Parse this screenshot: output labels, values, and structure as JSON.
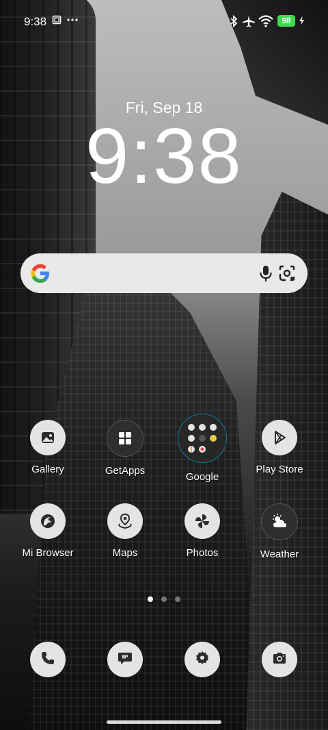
{
  "status_bar": {
    "time": "9:38",
    "battery": "98",
    "notification_icons": [
      "screenshot-icon",
      "more-dots-icon"
    ],
    "system_icons": [
      "bluetooth-icon",
      "airplane-icon",
      "wifi-icon",
      "battery-icon",
      "charging-icon"
    ],
    "battery_color": "#3ddc4f"
  },
  "lock_widget": {
    "date": "Fri, Sep 18",
    "time": "9:38"
  },
  "search": {
    "icons": [
      "google-logo-icon",
      "microphone-icon",
      "lens-camera-icon"
    ]
  },
  "apps_row1": [
    {
      "label": "Gallery",
      "icon": "gallery-icon"
    },
    {
      "label": "GetApps",
      "icon": "getapps-icon"
    },
    {
      "label": "Google",
      "icon": "google-folder-icon"
    },
    {
      "label": "Play Store",
      "icon": "play-store-icon"
    }
  ],
  "apps_row2": [
    {
      "label": "Mi Browser",
      "icon": "browser-icon"
    },
    {
      "label": "Maps",
      "icon": "maps-icon"
    },
    {
      "label": "Photos",
      "icon": "photos-icon"
    },
    {
      "label": "Weather",
      "icon": "weather-icon"
    }
  ],
  "page_indicator": {
    "pages": 3,
    "active": 1
  },
  "dock": [
    "phone-icon",
    "messages-icon",
    "settings-icon",
    "camera-icon"
  ]
}
